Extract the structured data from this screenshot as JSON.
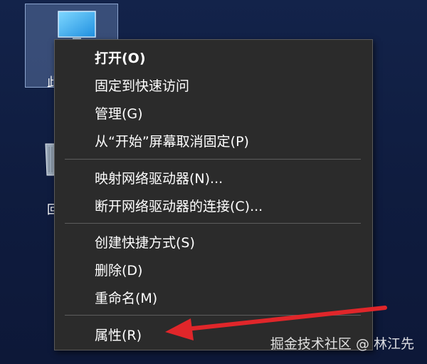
{
  "desktop": {
    "selected_icon": {
      "icon": "monitor-icon",
      "caption_partial": "此"
    },
    "recycle_icon": {
      "icon": "recycle-bin-icon",
      "caption_partial": "回"
    }
  },
  "context_menu": {
    "items": [
      {
        "label": "打开(O)",
        "bold": true
      },
      {
        "label": "固定到快速访问"
      },
      {
        "label": "管理(G)"
      },
      {
        "label": "从“开始”屏幕取消固定(P)"
      },
      {
        "label": "映射网络驱动器(N)..."
      },
      {
        "label": "断开网络驱动器的连接(C)..."
      },
      {
        "label": "创建快捷方式(S)"
      },
      {
        "label": "删除(D)"
      },
      {
        "label": "重命名(M)"
      },
      {
        "label": "属性(R)"
      }
    ]
  },
  "annotation": {
    "type": "arrow",
    "color": "#e0262a",
    "points_to": "属性(R)"
  },
  "watermark": "掘金技术社区 @ 林江先"
}
